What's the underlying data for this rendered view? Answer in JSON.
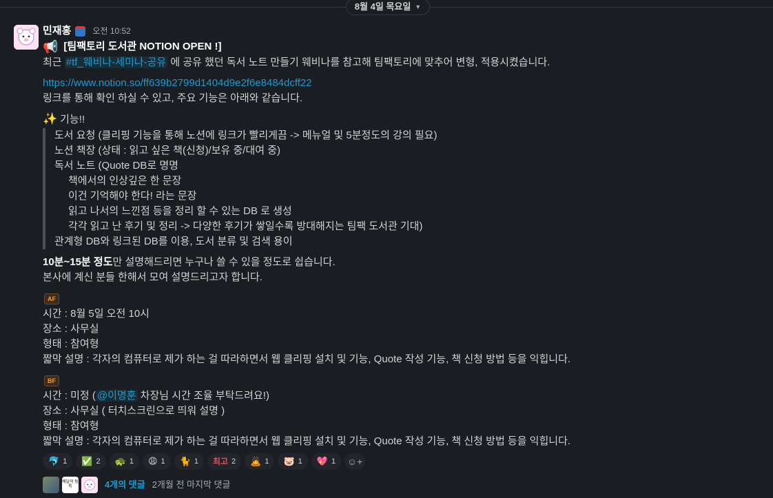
{
  "date_divider": {
    "label": "8월 4일 목요일"
  },
  "message": {
    "author": "민재홍",
    "time": "오전 10:52",
    "title": "[팀팩토리 도서관 NOTION OPEN !]",
    "intro_before": "최근 ",
    "intro_channel": "#tf_웨비나-세미나-공유",
    "intro_after": " 에 공유 했던 독서 노트 만들기 웨비나를 참고해 팀팩토리에 맞추어 변형, 적용시켰습니다.",
    "link": "https://www.notion.so/ff639b2799d1404d9e2f6e8484dcff22",
    "link_desc": "링크를 통해 확인 하실 수 있고, 주요 기능은 아래와 같습니다.",
    "features_title": "기능!!",
    "features": [
      "도서 요청 (클리핑 기능을 통해 노션에 링크가 빨리게끔 -> 메뉴얼 및 5분정도의 강의 필요)",
      "노션 책장 (상태 : 읽고 싶은 책(신청)/보유 중/대여 중)",
      "독서 노트 (Quote DB로 명명",
      "책에서의 인상깊은 한 문장",
      "이건 기억해야 한다! 라는 문장",
      "읽고 나서의 느낀점 등을 정리 할 수 있는 DB 로 생성",
      "각각 읽고 난 후기 및 정리 -> 다양한 후기가 쌓일수록 방대해지는 팀팩 도서관 기대)",
      "관계형 DB와 링크된 DB를 이용, 도서 분류 및 검색 용이"
    ],
    "summary_bold": "10분~15분 정도",
    "summary_rest": "만 설명해드리면 누구나 쓸 수 있을 정도로 쉽습니다.",
    "summary_line2": "본사에 계신 분들 한해서 모여 설명드리고자 합니다.",
    "af": {
      "badge": "AF",
      "time": "시간 : 8월 5일 오전 10시",
      "place": "장소 : 사무실",
      "format": "형태 : 참여형",
      "desc": "짧막 설명 : 각자의 컴퓨터로 제가 하는 걸 따라하면서 웹 클리핑 설치 및 기능, Quote 작성 기능, 책 신청 방법 등을 익힙니다."
    },
    "bf": {
      "badge": "BF",
      "time_before": "시간 : 미정 (",
      "time_mention": "@이명훈",
      "time_after": " 차장님 시간 조율 부탁드려요!)",
      "place": "장소 : 사무실 ( 터치스크린으로 띄워 설명 )",
      "format": "형태 : 참여형",
      "desc": "짧막 설명 : 각자의 컴퓨터로 제가 하는 걸 따라하면서 웹 클리핑 설치 및 기능, Quote 작성 기능, 책 신청 방법 등을 익힙니다."
    }
  },
  "reactions": [
    {
      "emoji": "🐬",
      "icon": "dolphin-icon",
      "count": "1"
    },
    {
      "emoji": "✅",
      "icon": "check-mark-icon",
      "count": "2"
    },
    {
      "emoji": "🐢",
      "icon": "turtle-icon",
      "count": "1"
    },
    {
      "emoji": "😩",
      "icon": "weary-face-icon",
      "count": "1"
    },
    {
      "emoji": "🐈",
      "icon": "cat-icon",
      "count": "1"
    },
    {
      "emoji": "최고",
      "icon": "best-text-icon",
      "count": "2"
    },
    {
      "emoji": "🙇",
      "icon": "bowing-person-icon",
      "count": "1"
    },
    {
      "emoji": "🐷",
      "icon": "pig-icon",
      "count": "1"
    },
    {
      "emoji": "💖",
      "icon": "sparkling-heart-icon",
      "count": "1"
    }
  ],
  "thread": {
    "replies": "4개의 댓글",
    "last_reply": "2개월 전 마지막 댓글",
    "avatar2_text": "배달의 팀특"
  },
  "colors": {
    "background": "#1a1d21",
    "text": "#d1d2d3",
    "link": "#1d9bd1",
    "badge": "#f29a3a"
  }
}
